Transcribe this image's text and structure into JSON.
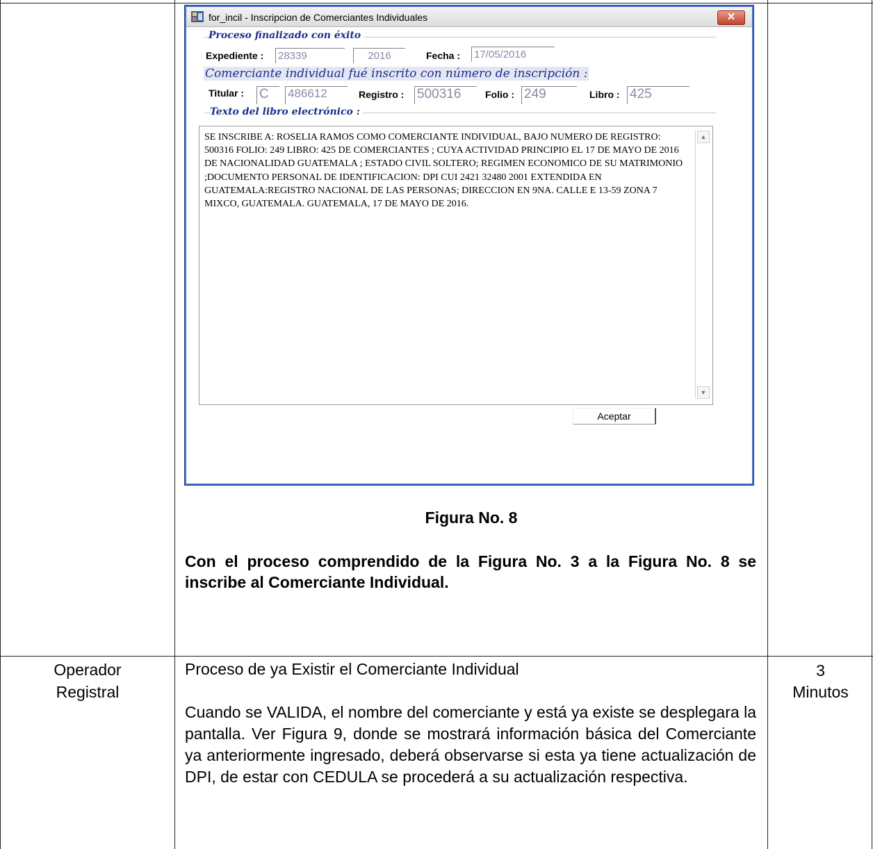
{
  "window": {
    "title": "for_incil - Inscripcion de Comerciantes Individuales",
    "close_glyph": "✕",
    "app_icon": "app-icon",
    "status_group_label": "Proceso finalizado con éxito",
    "expediente_label": "Expediente :",
    "expediente_number": "28339",
    "expediente_year": "2016",
    "fecha_label": "Fecha :",
    "fecha_value": "17/05/2016",
    "inscrito_text": "Comerciante individual fué inscrito con número de inscripción :",
    "titular_label": "Titular :",
    "titular_prefix": "C",
    "titular_number": "486612",
    "registro_label": "Registro :",
    "registro_value": "500316",
    "folio_label": "Folio :",
    "folio_value": "249",
    "libro_label": "Libro :",
    "libro_value": "425",
    "texto_group_label": "Texto del libro electrónico :",
    "texto_libro": "SE INSCRIBE A: ROSELIA RAMOS COMO COMERCIANTE INDIVIDUAL, BAJO NUMERO DE REGISTRO: 500316 FOLIO: 249 LIBRO: 425 DE COMERCIANTES ; CUYA ACTIVIDAD PRINCIPIO EL 17 DE MAYO DE 2016 DE NACIONALIDAD GUATEMALA ; ESTADO CIVIL SOLTERO; REGIMEN ECONOMICO DE SU MATRIMONIO ;DOCUMENTO PERSONAL DE IDENTIFICACION: DPI CUI 2421 32480 2001 EXTENDIDA EN GUATEMALA:REGISTRO NACIONAL DE LAS PERSONAS; DIRECCION EN 9NA. CALLE E 13-59 ZONA 7 MIXCO, GUATEMALA. GUATEMALA, 17 DE MAYO DE 2016.",
    "scroll_up_glyph": "▲",
    "scroll_down_glyph": "▼",
    "accept_button": "Aceptar"
  },
  "document": {
    "figure_caption": "Figura No. 8",
    "figure_note": "Con el proceso comprendido de la Figura No.  3 a la Figura No. 8 se inscribe al Comerciante Individual.",
    "row2_role": "Operador Registral",
    "row2_title": "Proceso de ya Existir el Comerciante Individual",
    "row2_body": "Cuando se VALIDA, el nombre del comerciante y está ya existe se desplegara la pantalla. Ver Figura 9, donde se mostrará información básica del Comerciante ya anteriormente ingresado, deberá observarse si esta ya tiene actualización de DPI, de estar con CEDULA se procederá a su actualización respectiva.",
    "row2_time": "3 Minutos"
  }
}
